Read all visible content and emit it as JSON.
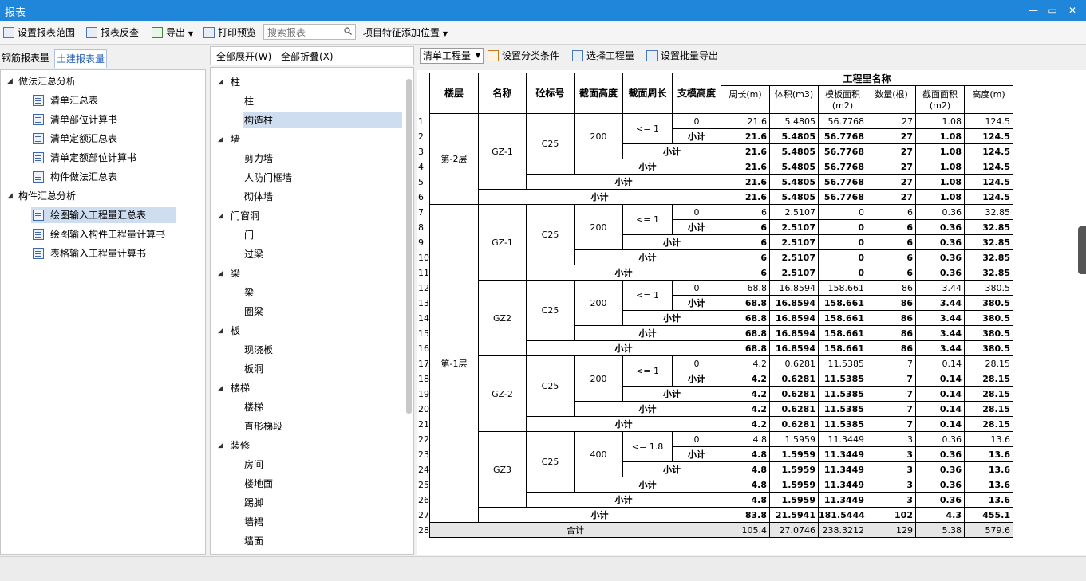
{
  "window": {
    "title": "报表",
    "min": "—",
    "restore": "▭",
    "close": "✕"
  },
  "toolbar": {
    "set_range": "设置报表范围",
    "report_check": "报表反查",
    "export": "导出",
    "print_preview": "打印预览",
    "search_placeholder": "搜索报表",
    "feature_position": "项目特征添加位置"
  },
  "left": {
    "tabs": [
      "钢筋报表量",
      "土建报表量"
    ],
    "active_tab": 1,
    "groups": [
      {
        "label": "做法汇总分析",
        "items": [
          "清单汇总表",
          "清单部位计算书",
          "清单定额汇总表",
          "清单定额部位计算书",
          "构件做法汇总表"
        ]
      },
      {
        "label": "构件汇总分析",
        "items": [
          "绘图输入工程量汇总表",
          "绘图输入构件工程量计算书",
          "表格输入工程量计算书"
        ]
      }
    ],
    "selected": "绘图输入工程量汇总表"
  },
  "middle": {
    "expand_all": "全部展开(W)",
    "collapse_all": "全部折叠(X)",
    "tree": [
      {
        "label": "柱",
        "children": [
          "柱",
          "构造柱"
        ]
      },
      {
        "label": "墙",
        "children": [
          "剪力墙",
          "人防门框墙",
          "砌体墙"
        ]
      },
      {
        "label": "门窗洞",
        "children": [
          "门",
          "过梁"
        ]
      },
      {
        "label": "梁",
        "children": [
          "梁",
          "圈梁"
        ]
      },
      {
        "label": "板",
        "children": [
          "现浇板",
          "板洞"
        ]
      },
      {
        "label": "楼梯",
        "children": [
          "楼梯",
          "直形梯段"
        ]
      },
      {
        "label": "装修",
        "children": [
          "房间",
          "楼地面",
          "踢脚",
          "墙裙",
          "墙面"
        ]
      }
    ],
    "selected": "构造柱"
  },
  "right": {
    "qty_select": "清单工程量",
    "set_category": "设置分类条件",
    "select_qty": "选择工程量",
    "batch_export": "设置批量导出",
    "headers": {
      "floor": "楼层",
      "name": "名称",
      "concrete": "砼标号",
      "section_h": "截面高度",
      "section_p": "截面周长",
      "form_h": "支模高度",
      "group": "工程里名称",
      "perimeter": "周长(m)",
      "volume": "体积(m3)",
      "formwork": "模板面积(m2)",
      "count": "数量(根)",
      "area": "截面面积(m2)",
      "height": "高度(m)"
    },
    "subtotal": "小计",
    "total": "合计",
    "floors": [
      {
        "floor": "第-2层",
        "members": [
          {
            "name": "GZ-1",
            "concrete": "C25",
            "section_h": "200",
            "section_p": "<= 1",
            "form_h": "0",
            "v": [
              "21.6",
              "5.4805",
              "56.7768",
              "27",
              "1.08",
              "124.5"
            ]
          }
        ],
        "sub": [
          "21.6",
          "5.4805",
          "56.7768",
          "27",
          "1.08",
          "124.5"
        ]
      },
      {
        "floor": "第-1层",
        "members": [
          {
            "name": "GZ-1",
            "concrete": "C25",
            "section_h": "200",
            "section_p": "<= 1",
            "form_h": "0",
            "v": [
              "6",
              "2.5107",
              "0",
              "6",
              "0.36",
              "32.85"
            ]
          },
          {
            "name": "GZ2",
            "concrete": "C25",
            "section_h": "200",
            "section_p": "<= 1",
            "form_h": "0",
            "v": [
              "68.8",
              "16.8594",
              "158.661",
              "86",
              "3.44",
              "380.5"
            ]
          },
          {
            "name": "GZ-2",
            "concrete": "C25",
            "section_h": "200",
            "section_p": "<= 1",
            "form_h": "0",
            "v": [
              "4.2",
              "0.6281",
              "11.5385",
              "7",
              "0.14",
              "28.15"
            ]
          },
          {
            "name": "GZ3",
            "concrete": "C25",
            "section_h": "400",
            "section_p": "<= 1.8",
            "form_h": "0",
            "v": [
              "4.8",
              "1.5959",
              "11.3449",
              "3",
              "0.36",
              "13.6"
            ]
          }
        ],
        "sub": [
          "83.8",
          "21.5941",
          "181.5444",
          "102",
          "4.3",
          "455.1"
        ]
      }
    ],
    "grand": [
      "105.4",
      "27.0746",
      "238.3212",
      "129",
      "5.38",
      "579.6"
    ]
  }
}
